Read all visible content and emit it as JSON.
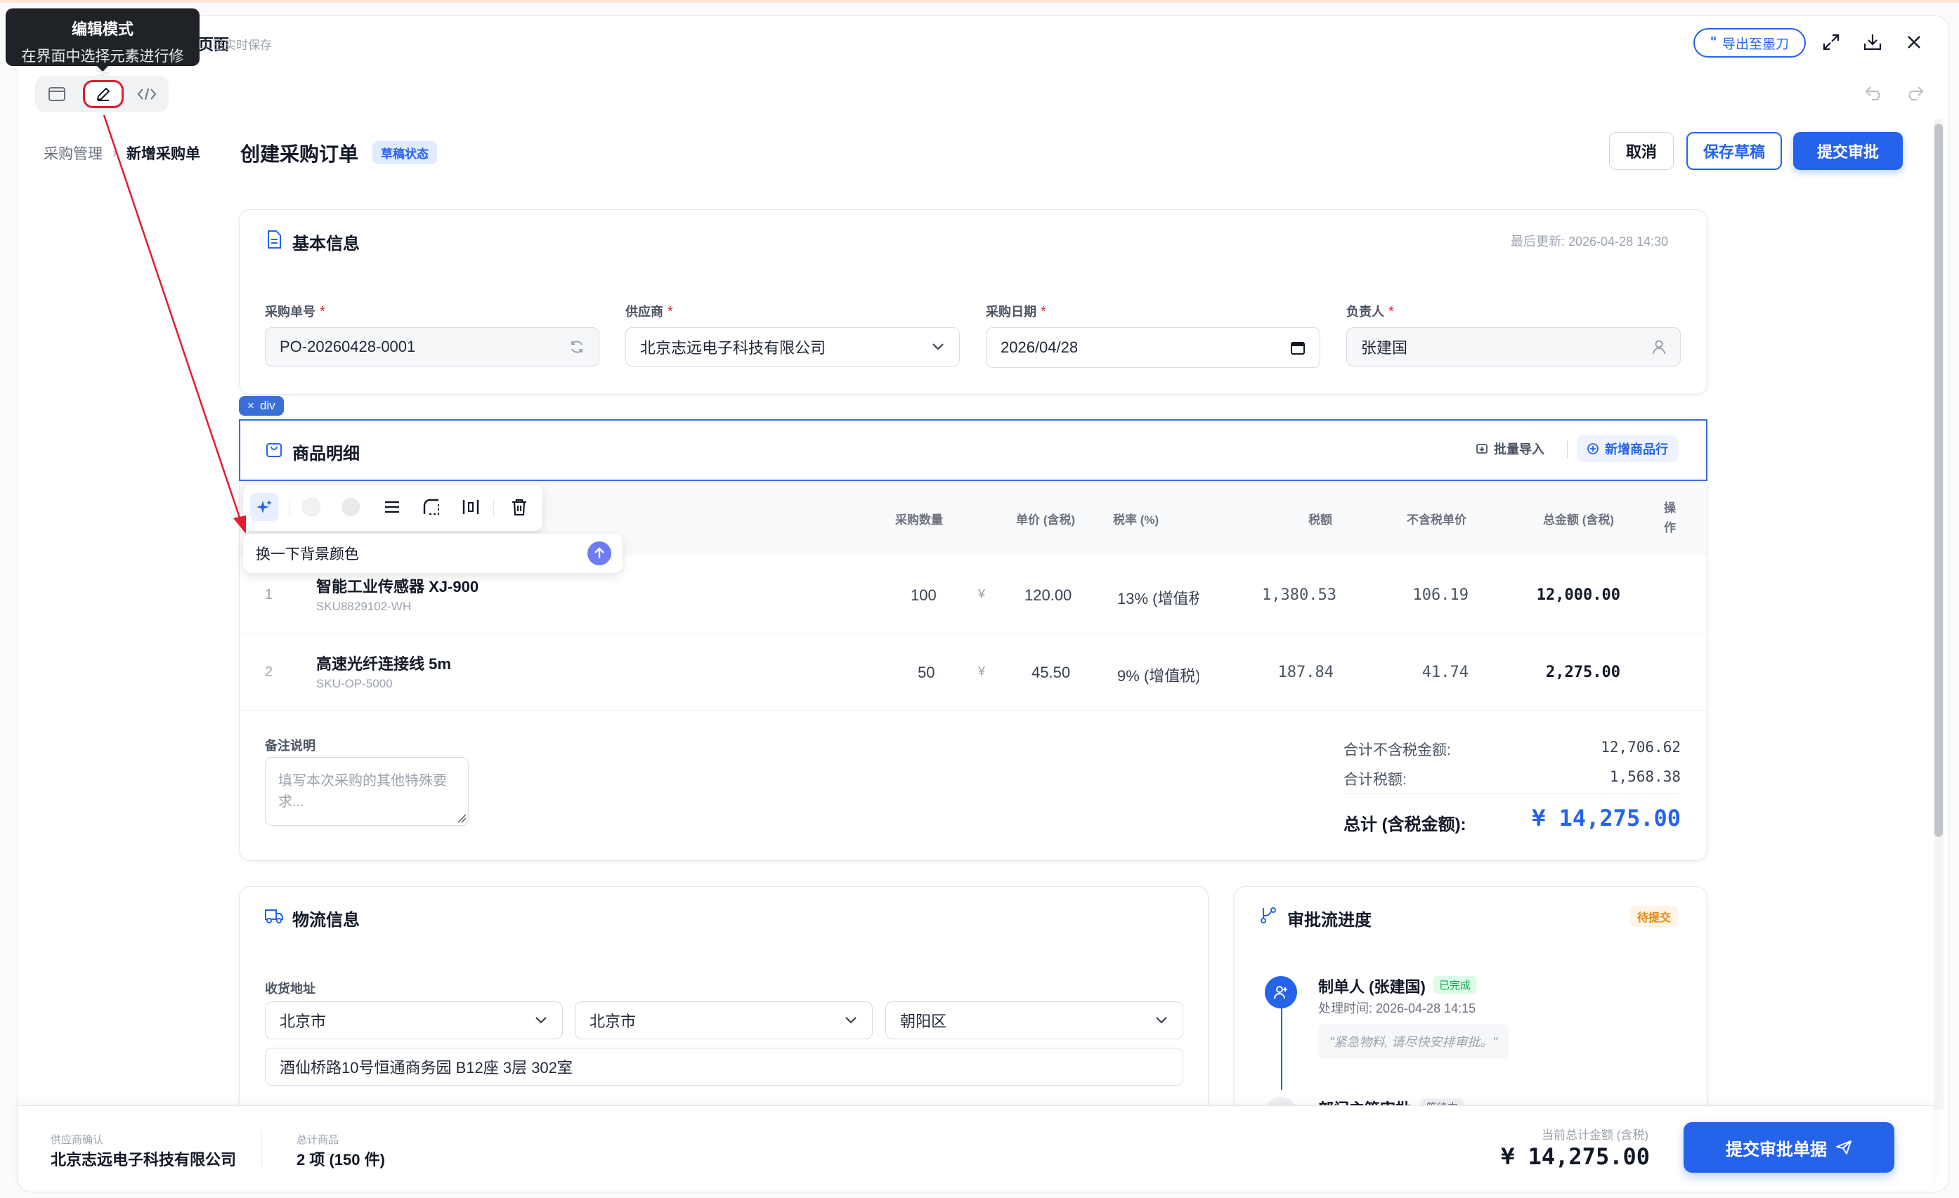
{
  "tooltip": {
    "title": "编辑模式",
    "desc": "在界面中选择元素进行修改"
  },
  "header": {
    "title_hidden": "创建采购订单页面",
    "autosave": "已实时保存",
    "export_label": "导出至墨刀"
  },
  "breadcrumb": {
    "root": "采购管理",
    "current": "新增采购单"
  },
  "page": {
    "title": "创建采购订单",
    "status": "草稿状态",
    "cancel": "取消",
    "save_draft": "保存草稿",
    "submit": "提交审批"
  },
  "basic": {
    "title": "基本信息",
    "updated": "最后更新: 2026-04-28 14:30",
    "po_label": "采购单号",
    "po_value": "PO-20260428-0001",
    "supplier_label": "供应商",
    "supplier_value": "北京志远电子科技有限公司",
    "date_label": "采购日期",
    "date_value": "2026/04/28",
    "owner_label": "负责人",
    "owner_value": "张建国",
    "asterisk": "*"
  },
  "selection_tag": "div",
  "products": {
    "title": "商品明细",
    "batch_import": "批量导入",
    "add_row": "新增商品行",
    "ai_prompt": "换一下背景颜色",
    "headers": {
      "qty": "采购数量",
      "price": "单价 (含税)",
      "tax_rate": "税率 (%)",
      "tax": "税额",
      "net": "不含税单价",
      "total": "总金额 (含税)",
      "op": "操作"
    },
    "currency_symbol": "¥",
    "rows": [
      {
        "index": "1",
        "name": "智能工业传感器 XJ-900",
        "sku": "SKU8829102-WH",
        "qty": "100",
        "price": "120.00",
        "tax_rate": "13% (增值税",
        "tax": "1,380.53",
        "net": "106.19",
        "total": "12,000.00"
      },
      {
        "index": "2",
        "name": "高速光纤连接线 5m",
        "sku": "SKU-OP-5000",
        "qty": "50",
        "price": "45.50",
        "tax_rate": "9% (增值税)",
        "tax": "187.84",
        "net": "41.74",
        "total": "2,275.00"
      }
    ],
    "remark_label": "备注说明",
    "remark_placeholder": "填写本次采购的其他特殊要求...",
    "sum_net_label": "合计不含税金额:",
    "sum_net": "12,706.62",
    "sum_tax_label": "合计税额:",
    "sum_tax": "1,568.38",
    "grand_label": "总计 (含税金额):",
    "grand": "¥ 14,275.00"
  },
  "logistics": {
    "title": "物流信息",
    "address_label": "收货地址",
    "province": "北京市",
    "city": "北京市",
    "district": "朝阳区",
    "detail": "酒仙桥路10号恒通商务园 B12座 3层 302室"
  },
  "approval": {
    "title": "审批流进度",
    "status": "待提交",
    "step1_name": "制单人 (张建国)",
    "step1_badge": "已完成",
    "step1_time": "处理时间: 2026-04-28 14:15",
    "step1_comment": "\"紧急物料, 请尽快安排审批。\"",
    "step2_name": "部门主管审批",
    "step2_badge": "等待中"
  },
  "footer": {
    "supplier_label": "供应商确认",
    "supplier_value": "北京志远电子科技有限公司",
    "items_label": "总计商品",
    "items_value": "2 项 (150 件)",
    "amount_label": "当前总计金额 (含税)",
    "amount": "¥ 14,275.00",
    "submit": "提交审批单据"
  },
  "colors": {
    "primary": "#2563eb",
    "danger": "#e02424",
    "success": "#16a34a",
    "warning": "#f59e0b"
  }
}
